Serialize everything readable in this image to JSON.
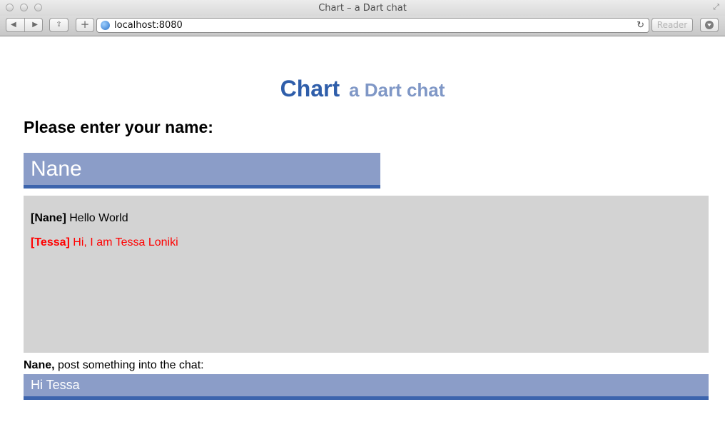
{
  "window": {
    "title": "Chart – a Dart chat"
  },
  "toolbar": {
    "back_icon": "◀",
    "forward_icon": "▶",
    "share_icon": "⇪",
    "add_icon": "+",
    "url": "localhost:8080",
    "reload_icon": "↻",
    "reader_label": "Reader"
  },
  "header": {
    "title": "Chart",
    "subtitle": "a Dart chat",
    "title_color": "#2f5eaa",
    "subtitle_color": "#7f97c6"
  },
  "name_section": {
    "prompt": "Please enter your name:",
    "value": "Nane"
  },
  "chat": {
    "messages": [
      {
        "author": "[Nane]",
        "text": "Hello World",
        "color": "#000000"
      },
      {
        "author": "[Tessa]",
        "text": "Hi, I am Tessa Loniki",
        "color": "#ff0000"
      }
    ]
  },
  "post": {
    "user": "Nane,",
    "label": " post something into the chat:",
    "value": "Hi Tessa"
  },
  "colors": {
    "input_bg": "#8b9dc8",
    "input_border": "#3c64ad",
    "chat_bg": "#d3d3d3"
  }
}
